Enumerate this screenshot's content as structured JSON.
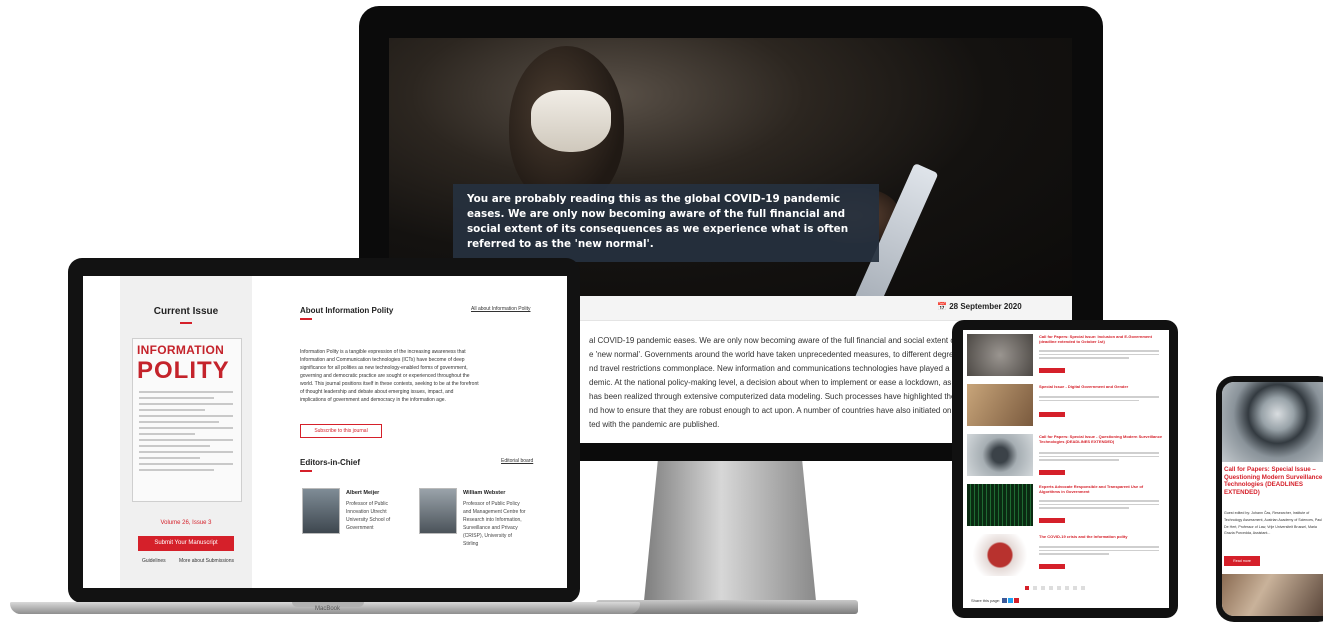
{
  "desktop": {
    "caption": "You are probably reading this as the global COVID-19 pandemic eases. We are only now becoming aware of the full financial and social extent of its consequences as we experience what is often referred to as the 'new normal'.",
    "date_icon": "calendar-icon",
    "date": "28 September 2020",
    "body_lines": [
      "al COVID-19 pandemic eases. We are only now becoming aware of the full financial and social extent of its co",
      "e 'new normal'. Governments around the world have taken unprecedented measures, to different degrees of",
      "nd travel restrictions commonplace. New information and communications technologies have played a centra",
      "demic. At the national policy-making level, a decision about when to implement or ease a lockdown, as well as",
      " has been realized through extensive computerized data modeling. Such processes have highlighted the diffe",
      "nd how to ensure that they are robust enough to act upon. A number of countries have also initiated online da",
      "ted with the pandemic are published."
    ]
  },
  "laptop": {
    "brand": "MacBook",
    "current_issue_title": "Current Issue",
    "cover_title_top": "INFORMATION",
    "cover_title_big": "POLITY",
    "volume": "Volume 26, Issue 3",
    "submit_label": "Submit Your Manuscript",
    "guidelines": "Guidelines",
    "more_submissions": "More about Submissions",
    "about_title": "About Information Polity",
    "about_link": "All about Information Polity",
    "about_text": "Information Polity is a tangible expression of the increasing awareness that Information and Communication technologies (ICTs) have become of deep significance for all polities as new technology-enabled forms of government, governing and democratic practice are sought or experienced throughout the world. This journal positions itself in these contexts, seeking to be at the forefront of thought leadership and debate about emerging issues, impact, and implications of government and democracy in the information age.",
    "subscribe_label": "Subscribe to this journal",
    "editors_title": "Editors-in-Chief",
    "editorial_board": "Editorial board",
    "editors": [
      {
        "name": "Albert Meijer",
        "role": "Professor of Public Innovation Utrecht University School of Government"
      },
      {
        "name": "William Webster",
        "role": "Professor of Public Policy and Management Centre for Research into Information, Surveillance and Privacy (CRISP), University of Stirling"
      }
    ]
  },
  "tablet": {
    "items": [
      {
        "title": "Call for Papers: Special Issue: Inclusion and E-Government (deadline extended to October 1st)",
        "thumb": "#6e6a66"
      },
      {
        "title": "Special Issue - Digital Government and Gender",
        "thumb": "#b58a5c"
      },
      {
        "title": "Call for Papers: Special Issue - Questioning Modern Surveillance Technologies (DEADLINES EXTENDED)",
        "thumb": "#8c949a"
      },
      {
        "title": "Experts Advocate Responsible and Transparent Use of Algorithms in Government",
        "thumb": "#0f3a1c"
      },
      {
        "title": "The COVID-19 crisis and the Information polity",
        "thumb": "#d4c8c4"
      }
    ],
    "share_label": "Share this page:"
  },
  "phone": {
    "title": "Call for Papers: Special Issue – Questioning Modern Surveillance Technologies (DEADLINES EXTENDED)",
    "guest_text": "Guest edited by: Johann Čas, Researcher, Institute of Technology Assessment, Austrian Academy of Sciences, Paul De Hert, Professor of Law, Vrije Universiteit Brussel, Maria Grazia Porcedda, Assistant...",
    "read_more": "Read more"
  }
}
